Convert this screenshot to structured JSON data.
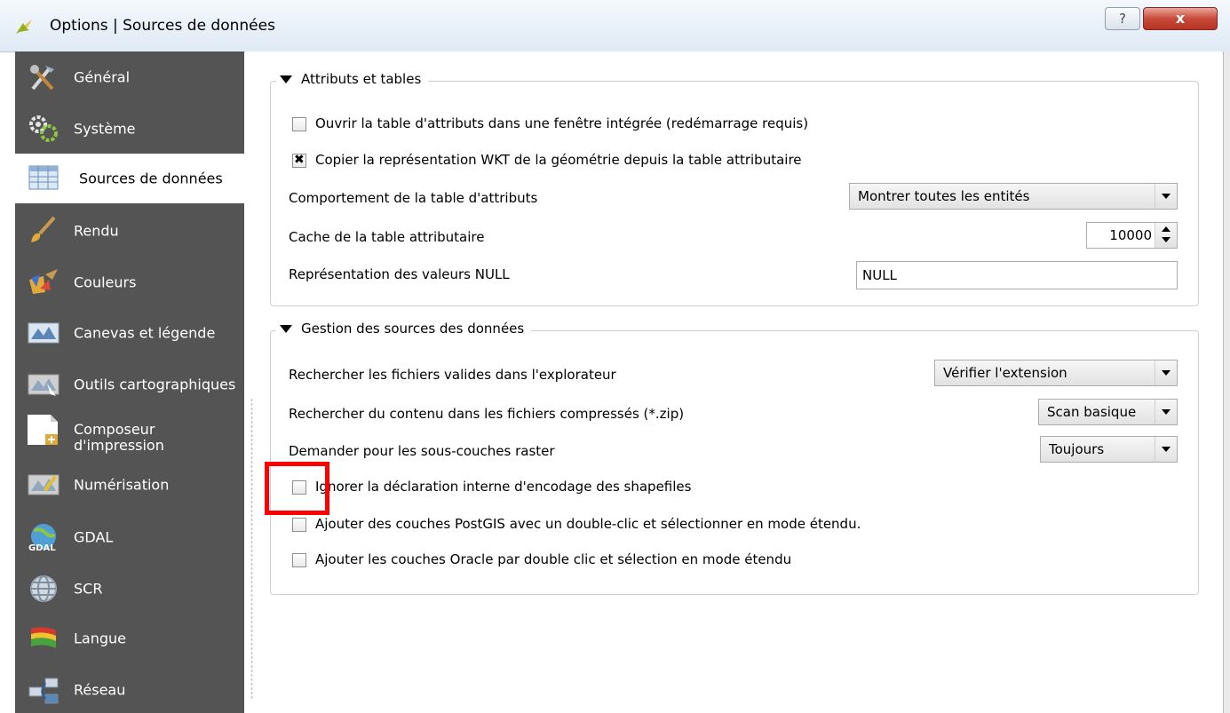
{
  "window": {
    "title": "Options | Sources de données",
    "help_label": "?",
    "close_label": "x"
  },
  "sidebar": {
    "items": [
      {
        "label": "Général",
        "icon": "tools-icon"
      },
      {
        "label": "Système",
        "icon": "gears-icon"
      },
      {
        "label": "Sources de données",
        "icon": "table-icon",
        "selected": true
      },
      {
        "label": "Rendu",
        "icon": "brush-icon"
      },
      {
        "label": "Couleurs",
        "icon": "palette-icon"
      },
      {
        "label": "Canevas et légende",
        "icon": "map-canvas-icon"
      },
      {
        "label": "Outils cartographiques",
        "icon": "map-tools-icon"
      },
      {
        "label": "Composeur d'impression",
        "icon": "print-composer-icon"
      },
      {
        "label": "Numérisation",
        "icon": "digitize-icon"
      },
      {
        "label": "GDAL",
        "icon": "gdal-icon"
      },
      {
        "label": "SCR",
        "icon": "globe-icon"
      },
      {
        "label": "Langue",
        "icon": "flag-icon"
      },
      {
        "label": "Réseau",
        "icon": "network-icon"
      }
    ]
  },
  "attributes_group": {
    "title": "Attributs et tables",
    "open_embedded": {
      "label": "Ouvrir la table d'attributs dans une fenêtre intégrée (redémarrage requis)",
      "checked": false
    },
    "copy_wkt": {
      "label": "Copier la représentation WKT de la géométrie depuis la table attributaire",
      "checked": true
    },
    "behavior": {
      "label": "Comportement de la table d'attributs",
      "value": "Montrer toutes les entités"
    },
    "cache": {
      "label": "Cache de la table attributaire",
      "value": "10000"
    },
    "null_repr": {
      "label": "Représentation des valeurs NULL",
      "value": "NULL"
    }
  },
  "datasources_group": {
    "title": "Gestion des sources des données",
    "scan_valid": {
      "label": "Rechercher les fichiers valides dans l'explorateur",
      "value": "Vérifier l'extension"
    },
    "scan_zip": {
      "label": "Rechercher du contenu dans les fichiers compressés (*.zip)",
      "value": "Scan basique"
    },
    "prompt_raster": {
      "label": "Demander pour les sous-couches raster",
      "value": "Toujours"
    },
    "ignore_encoding": {
      "label": "Ignorer la déclaration interne d'encodage des shapefiles",
      "checked": false
    },
    "postgis_dblclick": {
      "label": "Ajouter des couches PostGIS avec un double-clic et sélectionner en mode étendu.",
      "checked": false
    },
    "oracle_dblclick": {
      "label": "Ajouter les couches Oracle par double clic et sélection en mode étendu",
      "checked": false
    }
  },
  "colors": {
    "sidebar_bg": "#545454",
    "highlight": "#ff0000",
    "close_button": "#c74a3a"
  }
}
